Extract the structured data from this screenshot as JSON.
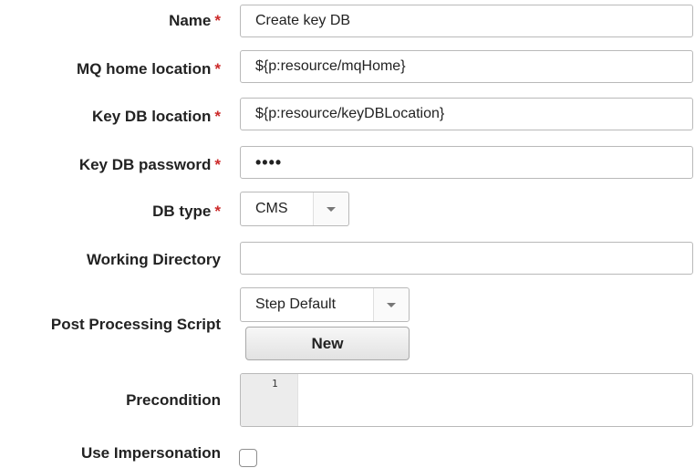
{
  "fields": {
    "name": {
      "label": "Name",
      "value": "Create key DB"
    },
    "mq_home": {
      "label": "MQ home location",
      "value": "${p:resource/mqHome}"
    },
    "key_db_location": {
      "label": "Key DB location",
      "value": "${p:resource/keyDBLocation}"
    },
    "key_db_password": {
      "label": "Key DB password",
      "value": "••••"
    },
    "db_type": {
      "label": "DB type",
      "selected": "CMS"
    },
    "working_directory": {
      "label": "Working Directory",
      "value": ""
    },
    "post_processing_script": {
      "label": "Post Processing Script",
      "selected": "Step Default",
      "new_button": "New"
    },
    "precondition": {
      "label": "Precondition",
      "line_number": "1"
    },
    "use_impersonation": {
      "label": "Use Impersonation",
      "checked": false
    }
  },
  "required_marker": "*",
  "colors": {
    "required": "#cc2a2a",
    "border": "#b9b9b9",
    "gutter": "#ececec"
  }
}
